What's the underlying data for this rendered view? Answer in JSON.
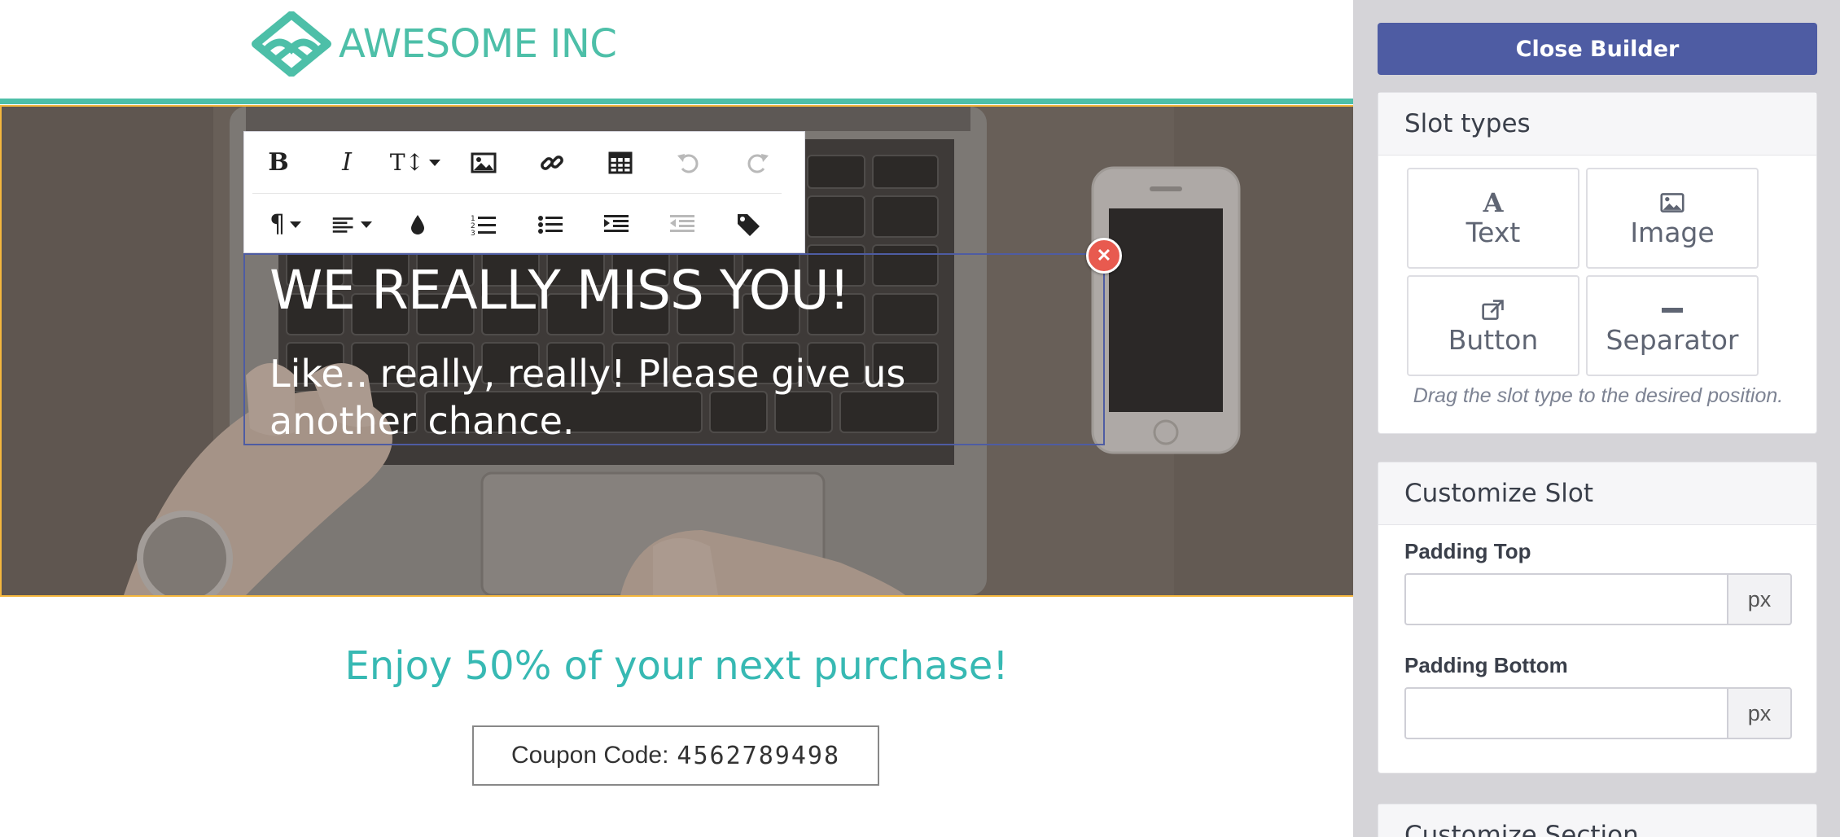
{
  "brand": {
    "name": "AWESOME INC",
    "color": "#4dbfa8"
  },
  "email": {
    "hero": {
      "heading": "WE REALLY MISS YOU!",
      "subtext": "Like.. really, really! Please give us another chance.",
      "selection_color": "#4e5ca3",
      "section_outline_color": "#f4b63d"
    },
    "editor_toolbar": {
      "row1": [
        {
          "icon": "bold-icon",
          "glyph": "B"
        },
        {
          "icon": "italic-icon",
          "glyph": "I"
        },
        {
          "icon": "font-size-icon",
          "glyph": "T↕"
        },
        {
          "icon": "insert-image-icon"
        },
        {
          "icon": "insert-link-icon"
        },
        {
          "icon": "insert-table-icon"
        },
        {
          "icon": "undo-icon",
          "state": "disabled"
        },
        {
          "icon": "redo-icon",
          "state": "disabled"
        }
      ],
      "row2": [
        {
          "icon": "paragraph-format-icon",
          "glyph": "¶"
        },
        {
          "icon": "align-icon"
        },
        {
          "icon": "text-color-icon"
        },
        {
          "icon": "ordered-list-icon"
        },
        {
          "icon": "unordered-list-icon"
        },
        {
          "icon": "indent-icon"
        },
        {
          "icon": "outdent-icon",
          "state": "disabled"
        },
        {
          "icon": "tag-icon"
        }
      ]
    },
    "offer_text": "Enjoy 50% of your next purchase!",
    "offer_color": "#37b9b3",
    "coupon": {
      "label": "Coupon Code:",
      "code": "4562789498"
    }
  },
  "builder": {
    "close_button": "Close Builder",
    "accent": "#4e5ca3",
    "slot_types": {
      "title": "Slot types",
      "items": [
        {
          "label": "Text",
          "icon": "text-font-icon"
        },
        {
          "label": "Image",
          "icon": "image-icon"
        },
        {
          "label": "Button",
          "icon": "external-link-icon"
        },
        {
          "label": "Separator",
          "icon": "separator-icon"
        }
      ],
      "hint": "Drag the slot type to the desired position."
    },
    "customize_slot": {
      "title": "Customize Slot",
      "padding_top": {
        "label": "Padding Top",
        "value": "",
        "unit": "px"
      },
      "padding_bottom": {
        "label": "Padding Bottom",
        "value": "",
        "unit": "px"
      }
    },
    "customize_section": {
      "title": "Customize Section"
    }
  }
}
